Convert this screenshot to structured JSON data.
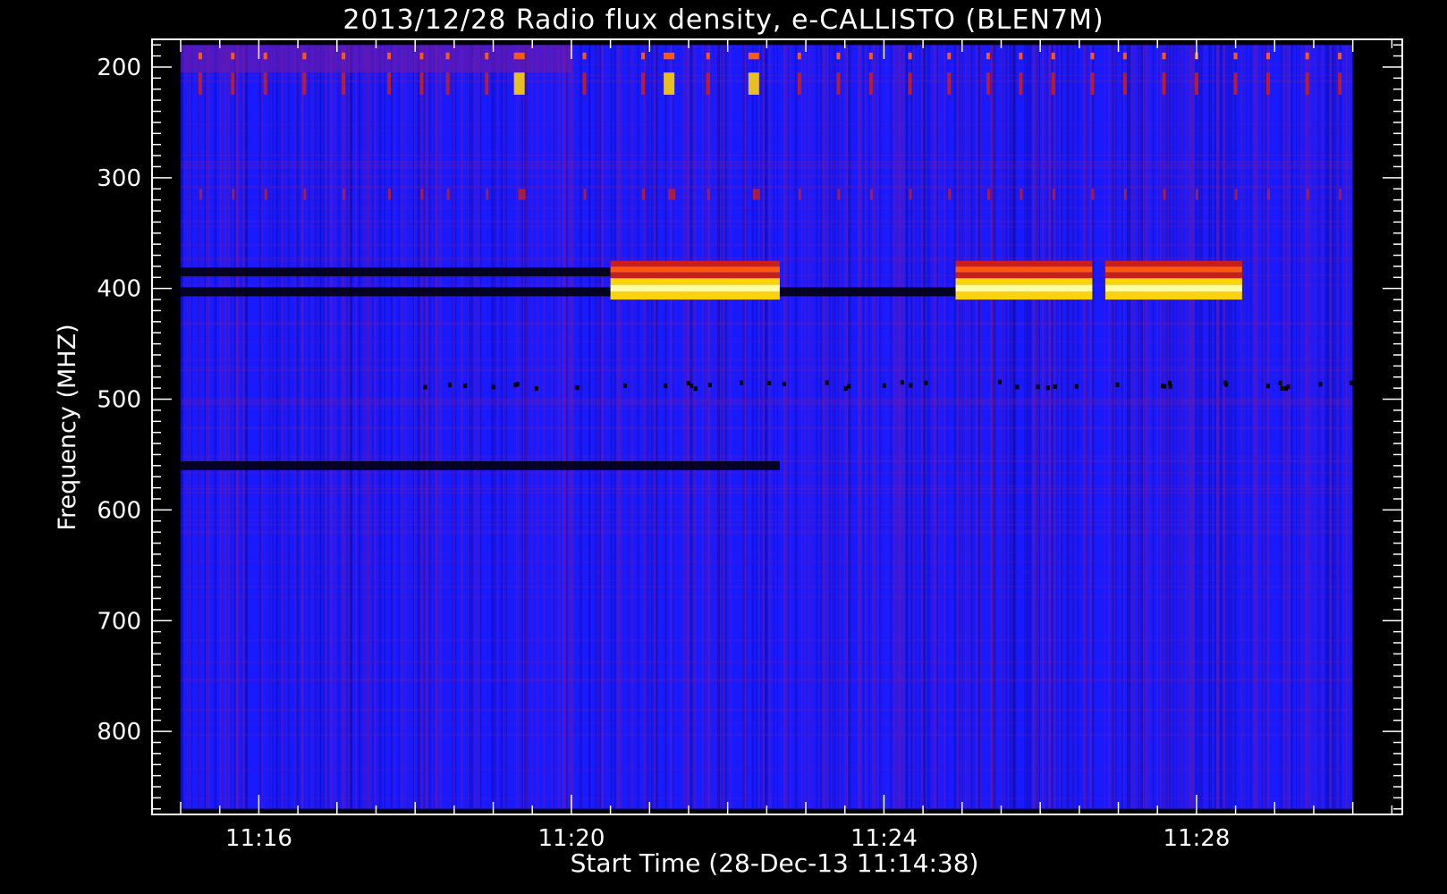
{
  "chart_data": {
    "type": "heatmap",
    "title": "2013/12/28  Radio flux density, e-CALLISTO (BLEN7M)",
    "xlabel": "Start Time (28-Dec-13 11:14:38)",
    "ylabel": "Frequency (MHZ)",
    "x_ticks": [
      "11:16",
      "11:20",
      "11:24",
      "11:28"
    ],
    "y_ticks": [
      200,
      300,
      400,
      500,
      600,
      700,
      800
    ],
    "x_range": [
      "11:14:38",
      "11:30:38"
    ],
    "y_range": [
      875,
      175
    ],
    "data_x_range": [
      "11:15:00",
      "11:30:00"
    ],
    "data_y_range": [
      870,
      180
    ],
    "colormap": [
      "#000000",
      "#0a0aa0",
      "#1a1aff",
      "#7a1a9a",
      "#c81e1e",
      "#ff5a0a",
      "#ffd20a",
      "#ffffa0"
    ],
    "background_color": "#1a1aff",
    "interference_bands": [
      {
        "start": "11:20:30",
        "end": "11:22:40",
        "f_low": 375,
        "f_high": 410,
        "peak": "bright"
      },
      {
        "start": "11:24:55",
        "end": "11:26:40",
        "f_low": 375,
        "f_high": 410,
        "peak": "bright"
      },
      {
        "start": "11:26:50",
        "end": "11:28:35",
        "f_low": 375,
        "f_high": 410,
        "peak": "bright"
      }
    ],
    "dark_lines": [
      {
        "start": "11:15:00",
        "end": "11:20:30",
        "freq": 385
      },
      {
        "start": "11:15:00",
        "end": "11:24:55",
        "freq": 403
      },
      {
        "start": "11:15:00",
        "end": "11:22:40",
        "freq": 560
      }
    ],
    "hot_columns": [
      "11:15:15",
      "11:15:40",
      "11:16:05",
      "11:16:35",
      "11:17:05",
      "11:17:40",
      "11:18:05",
      "11:18:25",
      "11:18:55",
      "11:19:20",
      "11:20:10",
      "11:20:55",
      "11:21:15",
      "11:21:45",
      "11:22:20",
      "11:22:55",
      "11:23:25",
      "11:23:50",
      "11:24:20",
      "11:24:50",
      "11:25:20",
      "11:25:45",
      "11:26:10",
      "11:26:40",
      "11:27:05",
      "11:27:35",
      "11:28:00",
      "11:28:30",
      "11:28:55",
      "11:29:25",
      "11:29:50"
    ]
  }
}
